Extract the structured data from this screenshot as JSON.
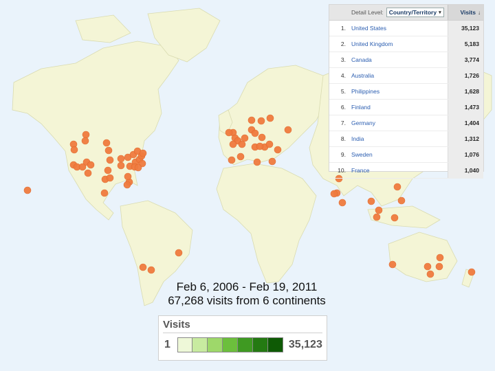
{
  "colors": {
    "background": "#eaf3fb",
    "land": "#f4f5d6",
    "marker": "#f07b3f",
    "link": "#2a5db0",
    "legend_scale": [
      "#eef8d8",
      "#c8eba0",
      "#9ed86a",
      "#6cbf3c",
      "#3f9a22",
      "#247a12",
      "#0e5a05"
    ]
  },
  "map_markers_label": "visit-location markers",
  "table": {
    "detail_level_label": "Detail Level:",
    "detail_level_value": "Country/Territory",
    "dropdown_icon": "caret-down",
    "visits_header": "Visits",
    "sort_icon": "arrow-down",
    "rows": [
      {
        "rank": "1.",
        "country": "United States",
        "visits": "35,123"
      },
      {
        "rank": "2.",
        "country": "United Kingdom",
        "visits": "5,183"
      },
      {
        "rank": "3.",
        "country": "Canada",
        "visits": "3,774"
      },
      {
        "rank": "4.",
        "country": "Australia",
        "visits": "1,726"
      },
      {
        "rank": "5.",
        "country": "Philippines",
        "visits": "1,628"
      },
      {
        "rank": "6.",
        "country": "Finland",
        "visits": "1,473"
      },
      {
        "rank": "7.",
        "country": "Germany",
        "visits": "1,404"
      },
      {
        "rank": "8.",
        "country": "India",
        "visits": "1,312"
      },
      {
        "rank": "9.",
        "country": "Sweden",
        "visits": "1,076"
      },
      {
        "rank": "10.",
        "country": "France",
        "visits": "1,040"
      }
    ]
  },
  "caption": {
    "date_range": "Feb 6, 2006 - Feb 19, 2011",
    "summary": "67,268 visits from 6 continents"
  },
  "legend": {
    "title": "Visits",
    "min": "1",
    "max": "35,123"
  }
}
